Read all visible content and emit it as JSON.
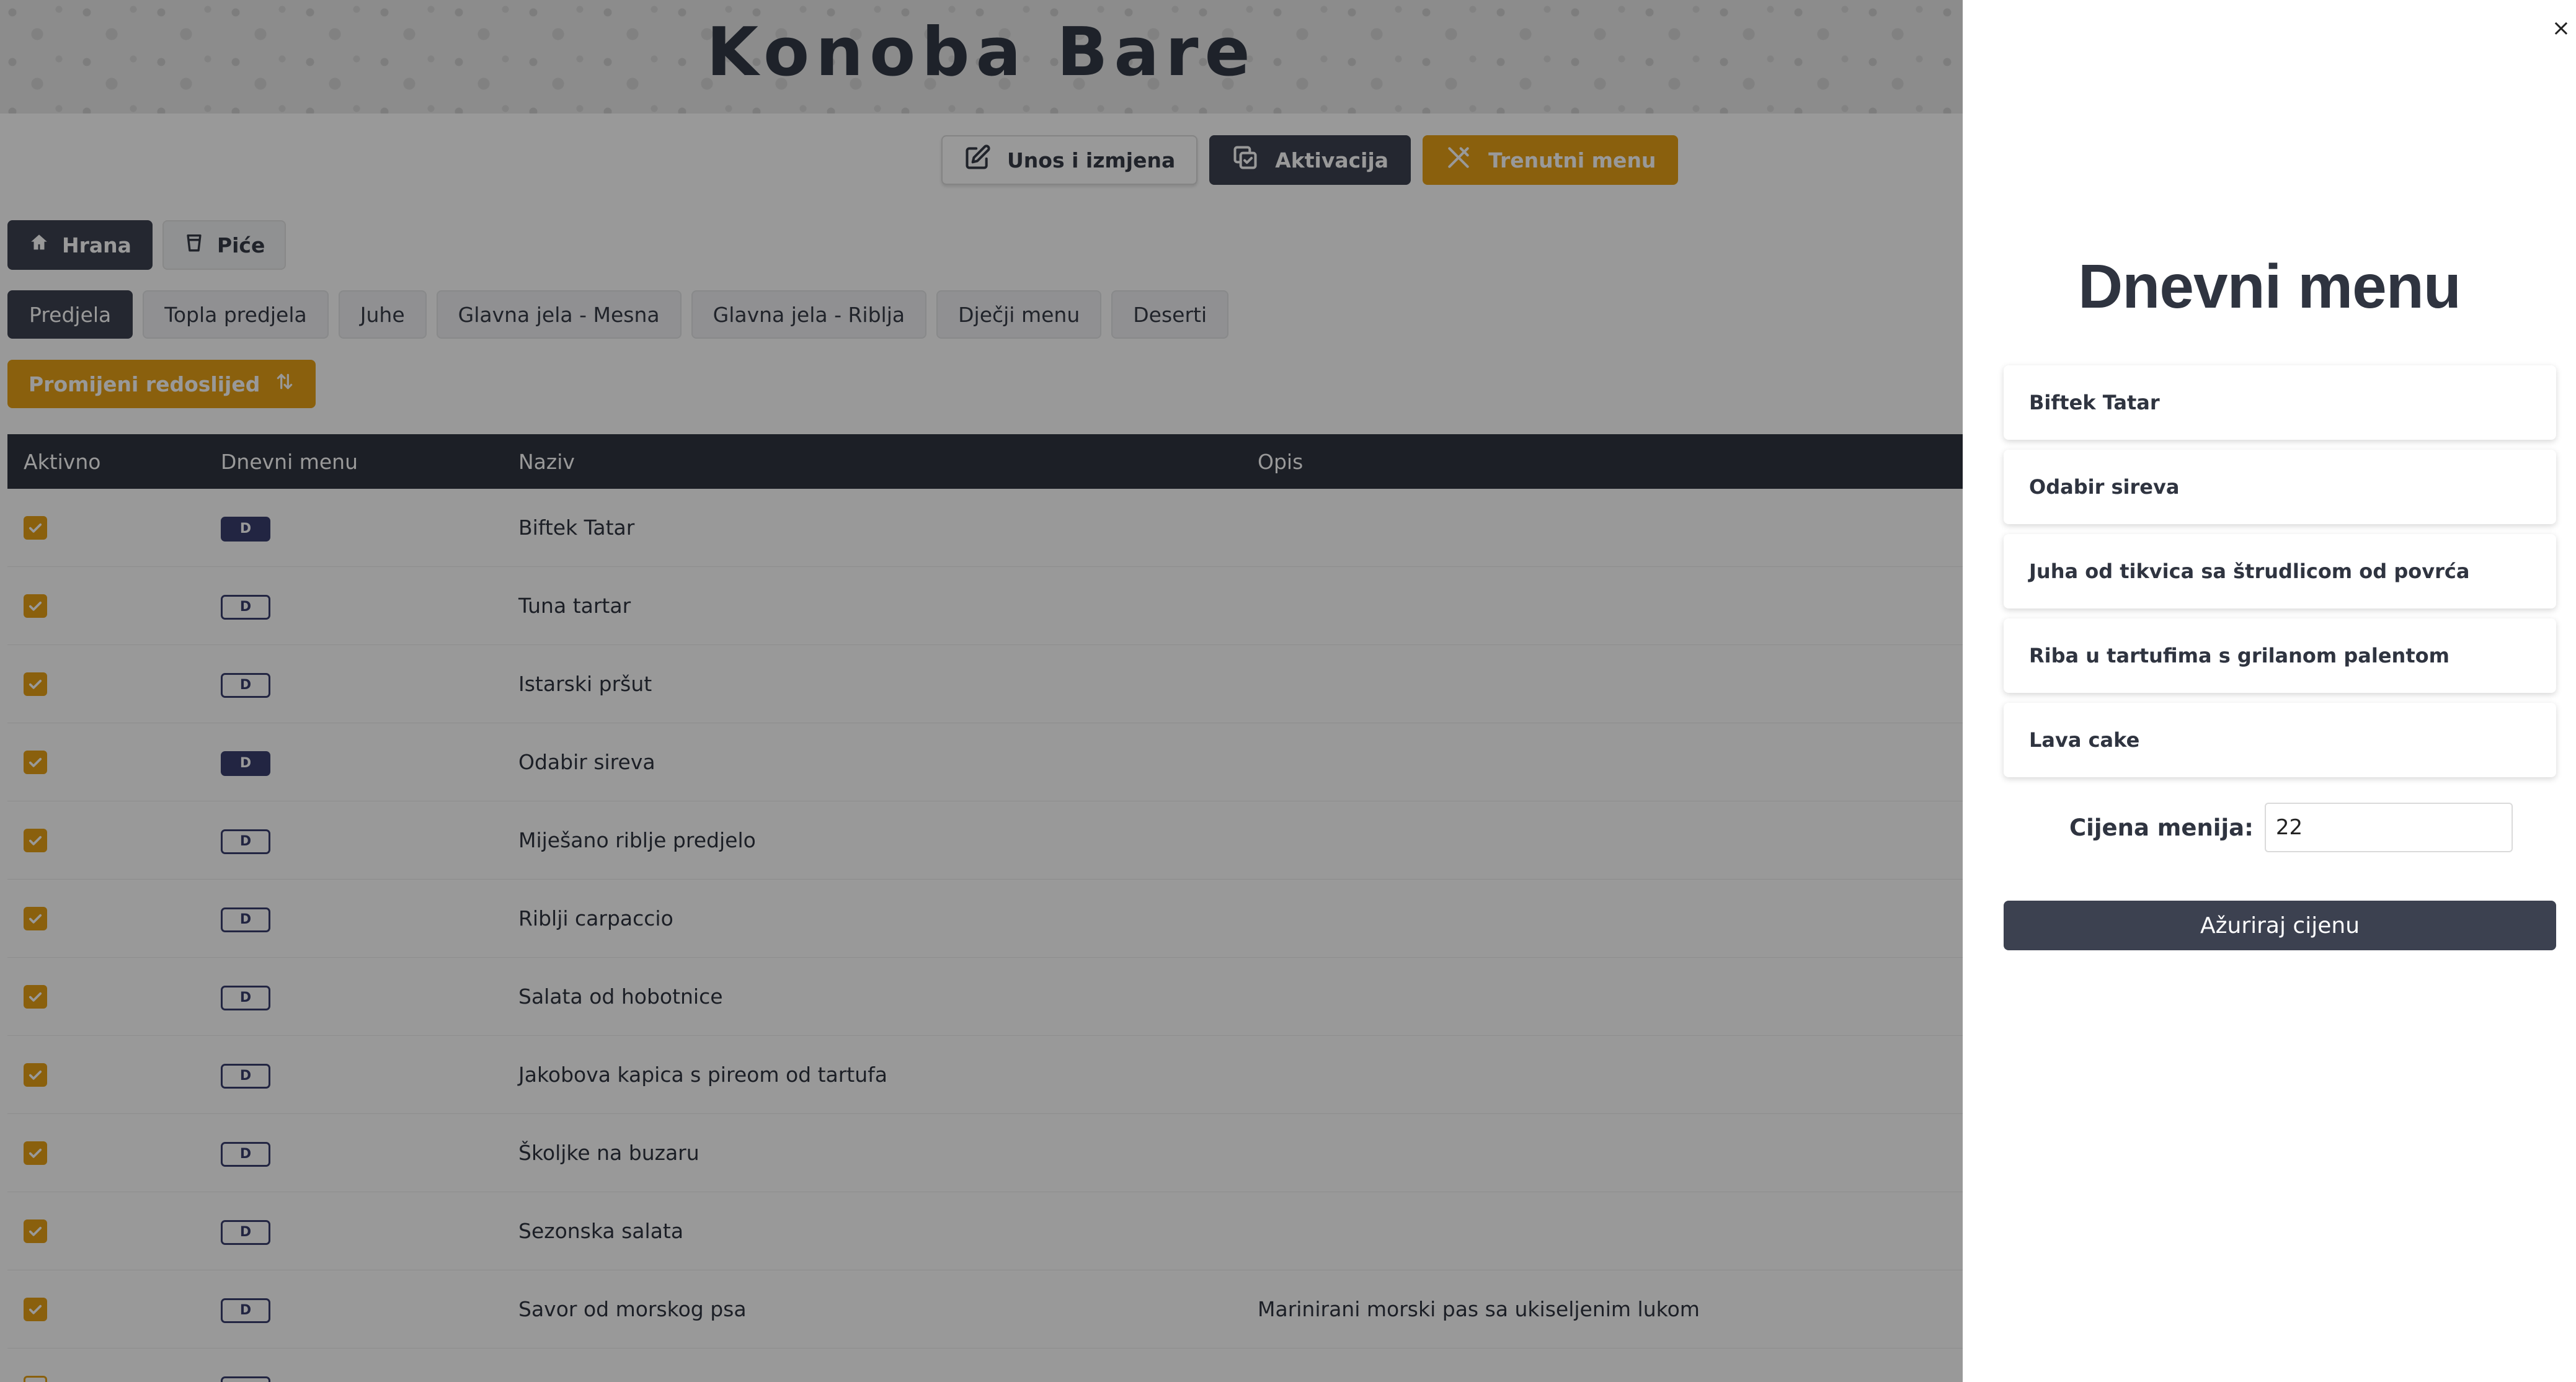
{
  "header": {
    "brand": "Konoba Bare",
    "actions": [
      {
        "label": "Unos i izmjena",
        "icon": "edit-icon",
        "style": "light"
      },
      {
        "label": "Aktivacija",
        "icon": "copy-check-icon",
        "style": "dark"
      },
      {
        "label": "Trenutni menu",
        "icon": "utensils-icon",
        "style": "gold"
      }
    ]
  },
  "category_tabs": [
    {
      "label": "Hrana",
      "icon": "home-icon",
      "active": true
    },
    {
      "label": "Piće",
      "icon": "cup-icon",
      "active": false
    }
  ],
  "sub_tabs": [
    {
      "label": "Predjela",
      "active": true
    },
    {
      "label": "Topla predjela",
      "active": false
    },
    {
      "label": "Juhe",
      "active": false
    },
    {
      "label": "Glavna jela - Mesna",
      "active": false
    },
    {
      "label": "Glavna jela - Riblja",
      "active": false
    },
    {
      "label": "Dječji menu",
      "active": false
    },
    {
      "label": "Deserti",
      "active": false
    }
  ],
  "reorder_label": "Promijeni redoslijed",
  "table": {
    "columns": [
      "Aktivno",
      "Dnevni menu",
      "Naziv",
      "Opis"
    ],
    "badge_letter": "D",
    "rows": [
      {
        "active": true,
        "daily": true,
        "name": "Biftek Tatar",
        "desc": ""
      },
      {
        "active": true,
        "daily": false,
        "name": "Tuna tartar",
        "desc": ""
      },
      {
        "active": true,
        "daily": false,
        "name": "Istarski pršut",
        "desc": ""
      },
      {
        "active": true,
        "daily": true,
        "name": "Odabir sireva",
        "desc": ""
      },
      {
        "active": true,
        "daily": false,
        "name": "Miješano riblje predjelo",
        "desc": ""
      },
      {
        "active": true,
        "daily": false,
        "name": "Riblji carpaccio",
        "desc": ""
      },
      {
        "active": true,
        "daily": false,
        "name": "Salata od hobotnice",
        "desc": ""
      },
      {
        "active": true,
        "daily": false,
        "name": "Jakobova kapica s pireom od tartufa",
        "desc": ""
      },
      {
        "active": true,
        "daily": false,
        "name": "Školjke na buzaru",
        "desc": ""
      },
      {
        "active": true,
        "daily": false,
        "name": "Sezonska salata",
        "desc": ""
      },
      {
        "active": true,
        "daily": false,
        "name": "Savor od morskog psa",
        "desc": "Marinirani morski pas sa ukiseljenim lukom"
      },
      {
        "active": false,
        "daily": false,
        "name": "",
        "desc": ""
      }
    ]
  },
  "drawer": {
    "close": "×",
    "title": "Dnevni menu",
    "items": [
      "Biftek Tatar",
      "Odabir sireva",
      "Juha od tikvica sa štrudlicom od povrća",
      "Riba u tartufima s grilanom palentom",
      "Lava cake"
    ],
    "price_label": "Cijena menija:",
    "price_value": "22",
    "update_label": "Ažuriraj cijenu"
  },
  "colors": {
    "gold": "#e6a117",
    "dark": "#3c4150",
    "badge": "#3a3f6e"
  }
}
